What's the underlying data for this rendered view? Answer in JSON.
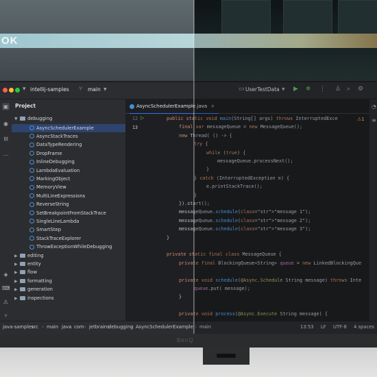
{
  "banner": {
    "text": "OK"
  },
  "titlebar": {
    "project_name": "intellij-samples",
    "branch": "main",
    "run_config": "UserTestData"
  },
  "project_panel": {
    "title": "Project",
    "root_folder": "debugging",
    "selected": "AsyncSchedulerExample",
    "classes": [
      "AsyncSchedulerExample",
      "AsyncStackTraces",
      "DataTypeRendering",
      "DropFrame",
      "InlineDebugging",
      "LambdaEvaluation",
      "MarkingObject",
      "MemoryView",
      "MultiLineExpressions",
      "ReverseString",
      "SetBreakpointFromStackTrace",
      "SingleLineLambda",
      "SmartStep",
      "StackTraceExplorer",
      "ThrowExceptionWhileDebugging"
    ],
    "folders": [
      "editing",
      "entity",
      "flow",
      "formatting",
      "generation",
      "inspections"
    ]
  },
  "editor": {
    "tab_label": "AsyncSchedulerExample.java",
    "warning_count": "1",
    "line_numbers": [
      "12",
      "13"
    ],
    "lines": [
      "public static void main(String[] args) throws InterruptedExce",
      "final var messageQueue = new MessageQueue();",
      "new Thread( () -> {",
      "try {",
      "while (true) {",
      "messageQueue.processNext();",
      "}",
      "} catch (InterruptedException e) {",
      "e.printStackTrace();",
      "}",
      "}).start();",
      "messageQueue.schedule(\"message 1\");",
      "messageQueue.schedule(\"message 2\");",
      "messageQueue.schedule(\"message 3\");",
      "}",
      "private static final class MessageQueue {",
      "private final BlockingQueue<String> queue = new LinkedBlockingQue",
      "private void schedule(@Async.Schedule String message) throws Inte",
      "queue.put( message);",
      "}",
      "private void process(@Async.Execute String message) {"
    ],
    "hints": {
      "target": "target:",
      "e": "e:"
    }
  },
  "statusbar": {
    "breadcrumbs": [
      "java-samples",
      "src",
      "main",
      "java",
      "com",
      "jetbrains",
      "debugging",
      "AsyncSchedulerExample",
      "main"
    ],
    "position": "13:53",
    "line_ending": "LF",
    "encoding": "UTF-8",
    "indent": "4 spaces"
  },
  "monitor": {
    "brand": "BenQ"
  },
  "colors": {
    "accent": "#3574f0",
    "selection": "#2e436e",
    "keyword": "#cf8e6d",
    "string": "#6aab73",
    "run_green": "#5fb865"
  }
}
